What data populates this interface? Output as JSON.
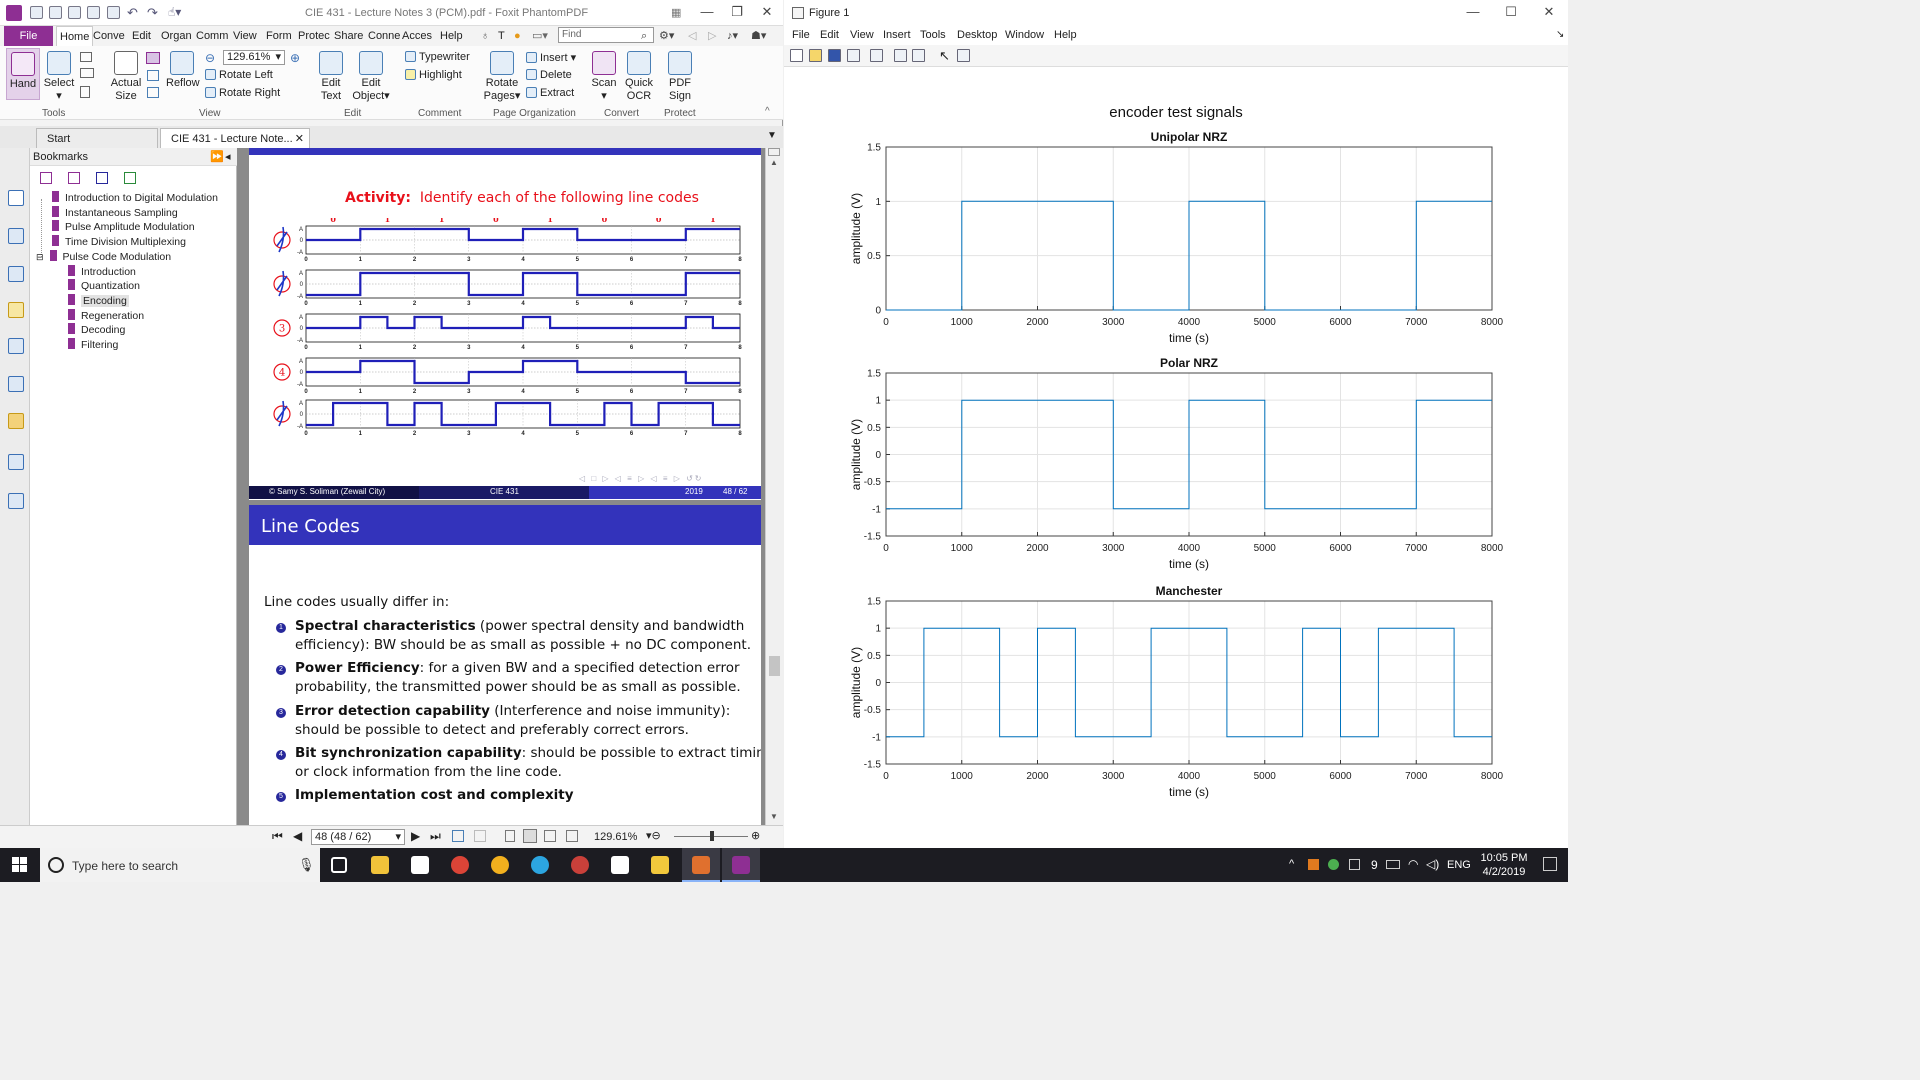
{
  "foxit": {
    "title": "CIE 431 - Lecture Notes 3 (PCM).pdf - Foxit PhantomPDF",
    "file_label": "File",
    "menu_tabs": [
      "Home",
      "Conve",
      "Edit",
      "Organ",
      "Comm",
      "View",
      "Form",
      "Protec",
      "Share",
      "Conne",
      "Acces",
      "Help"
    ],
    "find_placeholder": "Find",
    "tell_me": "T",
    "ribbon": {
      "hand": "Hand",
      "select": "Select",
      "actual_size_1": "Actual",
      "actual_size_2": "Size",
      "reflow": "Reflow",
      "zoom_value": "129.61%",
      "rotate_left": "Rotate Left",
      "rotate_right": "Rotate Right",
      "edit_text_1": "Edit",
      "edit_text_2": "Text",
      "edit_object_1": "Edit",
      "edit_object_2": "Object",
      "typewriter": "Typewriter",
      "highlight": "Highlight",
      "rotate_pages_1": "Rotate",
      "rotate_pages_2": "Pages",
      "insert": "Insert",
      "delete": "Delete",
      "extract": "Extract",
      "scan": "Scan",
      "quick_ocr_1": "Quick",
      "quick_ocr_2": "OCR",
      "pdf_sign_1": "PDF",
      "pdf_sign_2": "Sign",
      "groups": {
        "tools": "Tools",
        "view": "View",
        "edit": "Edit",
        "comment": "Comment",
        "page_org": "Page Organization",
        "convert": "Convert",
        "protect": "Protect"
      }
    },
    "doc_tabs": {
      "start": "Start",
      "current": "CIE 431 - Lecture Note..."
    },
    "bookmarks": {
      "title": "Bookmarks",
      "items": [
        "Introduction to Digital Modulation",
        "Instantaneous Sampling",
        "Pulse Amplitude Modulation",
        "Time Division Multiplexing",
        "Pulse Code Modulation"
      ],
      "children": [
        "Introduction",
        "Quantization",
        "Encoding",
        "Regeneration",
        "Decoding",
        "Filtering"
      ]
    },
    "slide1": {
      "activity_label": "Activity:",
      "activity_text": "Identify each of the following line codes",
      "bits": [
        "0",
        "1",
        "1",
        "0",
        "1",
        "0",
        "0",
        "1"
      ],
      "ticks": [
        "0",
        "1",
        "2",
        "3",
        "4",
        "5",
        "6",
        "7",
        "8"
      ],
      "row_numbers": [
        "3",
        "4"
      ],
      "footer_author": "© Samy S. Soliman  (Zewail City)",
      "footer_course": "CIE 431",
      "footer_year": "2019",
      "footer_page": "48 / 62"
    },
    "slide2": {
      "title": "Line Codes",
      "intro": "Line codes usually differ in:",
      "items": [
        {
          "bold": "Spectral characteristics",
          "rest": " (power spectral density and bandwidth",
          "line2": "efficiency): BW should be as small as possible + no DC component."
        },
        {
          "bold": "Power Efficiency",
          "rest": ": for a given BW and a specified detection error",
          "line2": "probability, the transmitted power should be as small as possible."
        },
        {
          "bold": "Error detection capability",
          "rest": " (Interference and noise immunity):",
          "line2": "should be possible to detect and preferably correct errors."
        },
        {
          "bold": "Bit synchronization capability",
          "rest": ": should be possible to extract timing",
          "line2": "or clock information from the line code."
        },
        {
          "bold": "Implementation cost and complexity",
          "rest": "",
          "line2": ""
        }
      ]
    },
    "status": {
      "page_box": "48 (48 / 62)",
      "zoom": "129.61%"
    }
  },
  "figure": {
    "title": "Figure 1",
    "menu": [
      "File",
      "Edit",
      "View",
      "Insert",
      "Tools",
      "Desktop",
      "Window",
      "Help"
    ],
    "suptitle": "encoder test signals"
  },
  "chart_data": [
    {
      "type": "line",
      "title": "Unipolar NRZ",
      "xlabel": "time (s)",
      "ylabel": "amplitude (V)",
      "xlim": [
        0,
        8000
      ],
      "ylim": [
        0,
        1.5
      ],
      "xticks": [
        0,
        1000,
        2000,
        3000,
        4000,
        5000,
        6000,
        7000,
        8000
      ],
      "yticks": [
        0,
        0.5,
        1,
        1.5
      ],
      "grid": true,
      "color": "#0072bd",
      "x": [
        0,
        1000,
        1000,
        3000,
        3000,
        4000,
        4000,
        5000,
        5000,
        7000,
        7000,
        8000
      ],
      "y": [
        0,
        0,
        1,
        1,
        0,
        0,
        1,
        1,
        0,
        0,
        1,
        1
      ]
    },
    {
      "type": "line",
      "title": "Polar NRZ",
      "xlabel": "time (s)",
      "ylabel": "amplitude (V)",
      "xlim": [
        0,
        8000
      ],
      "ylim": [
        -1.5,
        1.5
      ],
      "xticks": [
        0,
        1000,
        2000,
        3000,
        4000,
        5000,
        6000,
        7000,
        8000
      ],
      "yticks": [
        -1.5,
        -1,
        -0.5,
        0,
        0.5,
        1,
        1.5
      ],
      "grid": true,
      "color": "#0072bd",
      "x": [
        0,
        1000,
        1000,
        3000,
        3000,
        4000,
        4000,
        5000,
        5000,
        7000,
        7000,
        8000
      ],
      "y": [
        -1,
        -1,
        1,
        1,
        -1,
        -1,
        1,
        1,
        -1,
        -1,
        1,
        1
      ]
    },
    {
      "type": "line",
      "title": "Manchester",
      "xlabel": "time (s)",
      "ylabel": "amplitude (V)",
      "xlim": [
        0,
        8000
      ],
      "ylim": [
        -1.5,
        1.5
      ],
      "xticks": [
        0,
        1000,
        2000,
        3000,
        4000,
        5000,
        6000,
        7000,
        8000
      ],
      "yticks": [
        -1.5,
        -1,
        -0.5,
        0,
        0.5,
        1,
        1.5
      ],
      "grid": true,
      "color": "#0072bd",
      "x": [
        0,
        500,
        500,
        1500,
        1500,
        2000,
        2000,
        2500,
        2500,
        3500,
        3500,
        4500,
        4500,
        5500,
        5500,
        6000,
        6000,
        6500,
        6500,
        7500,
        7500,
        8000
      ],
      "y": [
        -1,
        -1,
        1,
        1,
        -1,
        -1,
        1,
        1,
        -1,
        -1,
        1,
        1,
        -1,
        -1,
        1,
        1,
        -1,
        -1,
        1,
        1,
        -1,
        -1
      ]
    }
  ],
  "taskbar": {
    "search_placeholder": "Type here to search",
    "time": "10:05 PM",
    "date": "4/2/2019",
    "lang": "ENG",
    "badge": "9"
  },
  "colors": {
    "foxit_purple": "#8e2f93",
    "slide_blue": "#3333bb",
    "matlab_blue": "#0072bd",
    "activity_red": "#e8101a"
  }
}
